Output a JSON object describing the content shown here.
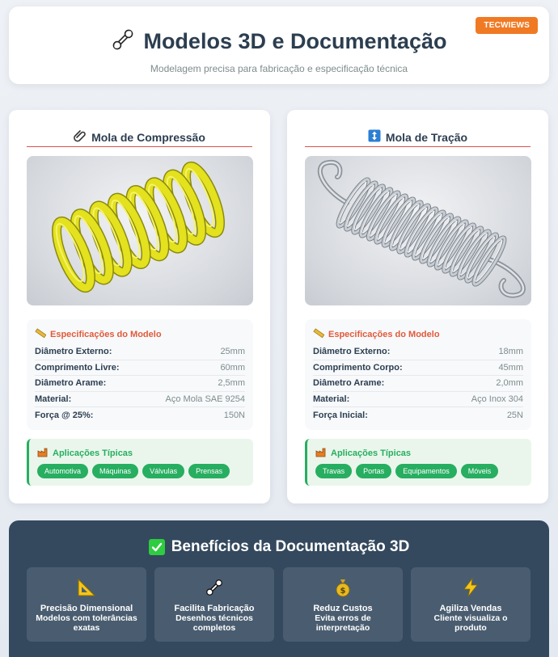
{
  "header": {
    "badge": "TECWIEWS",
    "title": "Modelos 3D e Documentação",
    "subtitle": "Modelagem precisa para fabricação e especificação técnica",
    "icon": "wrench-icon"
  },
  "cards": [
    {
      "title": "Mola de Compressão",
      "icon": "paperclip-icon",
      "image": "yellow-compression-spring",
      "specs_title": "Especificações do Modelo",
      "specs": [
        {
          "label": "Diâmetro Externo:",
          "value": "25mm"
        },
        {
          "label": "Comprimento Livre:",
          "value": "60mm"
        },
        {
          "label": "Diâmetro Arame:",
          "value": "2,5mm"
        },
        {
          "label": "Material:",
          "value": "Aço Mola SAE 9254"
        },
        {
          "label": "Força @ 25%:",
          "value": "150N"
        }
      ],
      "apps_title": "Aplicações Típicas",
      "tags": [
        "Automotiva",
        "Máquinas",
        "Válvulas",
        "Prensas"
      ]
    },
    {
      "title": "Mola de Tração",
      "icon": "up-down-arrow-icon",
      "image": "steel-extension-spring",
      "specs_title": "Especificações do Modelo",
      "specs": [
        {
          "label": "Diâmetro Externo:",
          "value": "18mm"
        },
        {
          "label": "Comprimento Corpo:",
          "value": "45mm"
        },
        {
          "label": "Diâmetro Arame:",
          "value": "2,0mm"
        },
        {
          "label": "Material:",
          "value": "Aço Inox 304"
        },
        {
          "label": "Força Inicial:",
          "value": "25N"
        }
      ],
      "apps_title": "Aplicações Típicas",
      "tags": [
        "Travas",
        "Portas",
        "Equipamentos",
        "Móveis"
      ]
    }
  ],
  "benefits": {
    "title": "Benefícios da Documentação 3D",
    "items": [
      {
        "title": "Precisão Dimensional",
        "desc": "Modelos com tolerâncias exatas",
        "icon": "triangle-ruler-icon"
      },
      {
        "title": "Facilita Fabricação",
        "desc": "Desenhos técnicos completos",
        "icon": "wrench-icon"
      },
      {
        "title": "Reduz Custos",
        "desc": "Evita erros de interpretação",
        "icon": "money-bag-icon"
      },
      {
        "title": "Agiliza Vendas",
        "desc": "Cliente visualiza o produto",
        "icon": "lightning-icon"
      }
    ]
  },
  "colors": {
    "accent_orange": "#f07a24",
    "spec_title_red": "#e05a3a",
    "green": "#27ae60",
    "dark_panel": "#34495e"
  }
}
